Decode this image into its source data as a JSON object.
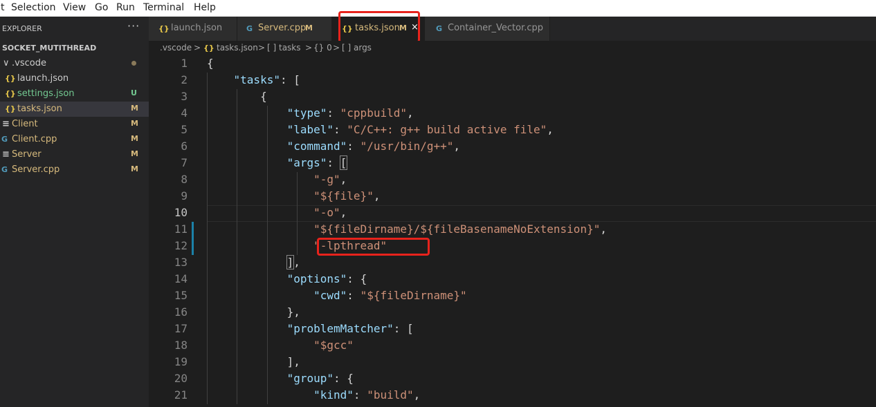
{
  "menu": [
    "t",
    "Selection",
    "View",
    "Go",
    "Run",
    "Terminal",
    "Help"
  ],
  "explorer": {
    "title": "EXPLORER",
    "more": "···",
    "project": "SOCKET_MUTITHREAD",
    "items": [
      {
        "label": ".vscode",
        "badge": "",
        "icon": "",
        "kind": "folder"
      },
      {
        "label": "launch.json",
        "badge": "",
        "icon": "{}",
        "kind": "json"
      },
      {
        "label": "settings.json",
        "badge": "U",
        "icon": "{}",
        "kind": "json"
      },
      {
        "label": "tasks.json",
        "badge": "M",
        "icon": "{}",
        "kind": "json"
      },
      {
        "label": "Client",
        "badge": "M",
        "icon": "≡",
        "kind": "binary"
      },
      {
        "label": "Client.cpp",
        "badge": "M",
        "icon": "G",
        "kind": "cpp"
      },
      {
        "label": "Server",
        "badge": "M",
        "icon": "≡",
        "kind": "binary"
      },
      {
        "label": "Server.cpp",
        "badge": "M",
        "icon": "G",
        "kind": "cpp"
      }
    ]
  },
  "tabs": [
    {
      "label": "launch.json",
      "badge": "",
      "icon": "{}"
    },
    {
      "label": "Server.cpp",
      "badge": "M",
      "icon": "G"
    },
    {
      "label": "tasks.json",
      "badge": "M",
      "icon": "{}",
      "close": "×"
    },
    {
      "label": "Container_Vector.cpp",
      "badge": "",
      "icon": "G"
    }
  ],
  "breadcrumb": [
    ".vscode",
    ">",
    "{}",
    "tasks.json",
    ">",
    "[ ] tasks",
    ">",
    "{} 0",
    ">",
    "[ ] args"
  ],
  "editor": {
    "line_numbers": [
      "1",
      "2",
      "3",
      "4",
      "5",
      "6",
      "7",
      "8",
      "9",
      "10",
      "11",
      "12",
      "13",
      "14",
      "15",
      "16",
      "17",
      "18",
      "19",
      "20",
      "21"
    ],
    "current_line": "10",
    "lines": [
      [
        [
          "p",
          "{"
        ]
      ],
      [
        [
          "p",
          "    "
        ],
        [
          "k",
          "\"tasks\""
        ],
        [
          "p",
          ": ["
        ]
      ],
      [
        [
          "p",
          "        {"
        ]
      ],
      [
        [
          "p",
          "            "
        ],
        [
          "k",
          "\"type\""
        ],
        [
          "p",
          ": "
        ],
        [
          "s",
          "\"cppbuild\""
        ],
        [
          "p",
          ","
        ]
      ],
      [
        [
          "p",
          "            "
        ],
        [
          "k",
          "\"label\""
        ],
        [
          "p",
          ": "
        ],
        [
          "s",
          "\"C/C++: g++ build active file\""
        ],
        [
          "p",
          ","
        ]
      ],
      [
        [
          "p",
          "            "
        ],
        [
          "k",
          "\"command\""
        ],
        [
          "p",
          ": "
        ],
        [
          "s",
          "\"/usr/bin/g++\""
        ],
        [
          "p",
          ","
        ]
      ],
      [
        [
          "p",
          "            "
        ],
        [
          "k",
          "\"args\""
        ],
        [
          "p",
          ": "
        ],
        [
          "m",
          "["
        ]
      ],
      [
        [
          "p",
          "                "
        ],
        [
          "s",
          "\"-g\""
        ],
        [
          "p",
          ","
        ]
      ],
      [
        [
          "p",
          "                "
        ],
        [
          "s",
          "\"${file}\""
        ],
        [
          "p",
          ","
        ]
      ],
      [
        [
          "p",
          "                "
        ],
        [
          "s",
          "\"-o\""
        ],
        [
          "p",
          ","
        ]
      ],
      [
        [
          "p",
          "                "
        ],
        [
          "s",
          "\"${fileDirname}/${fileBasenameNoExtension}\""
        ],
        [
          "p",
          ","
        ]
      ],
      [
        [
          "p",
          "                "
        ],
        [
          "s",
          "\"-lpthread\""
        ]
      ],
      [
        [
          "p",
          "            "
        ],
        [
          "m",
          "]"
        ],
        [
          "p",
          ","
        ]
      ],
      [
        [
          "p",
          "            "
        ],
        [
          "k",
          "\"options\""
        ],
        [
          "p",
          ": {"
        ]
      ],
      [
        [
          "p",
          "                "
        ],
        [
          "k",
          "\"cwd\""
        ],
        [
          "p",
          ": "
        ],
        [
          "s",
          "\"${fileDirname}\""
        ]
      ],
      [
        [
          "p",
          "            },"
        ]
      ],
      [
        [
          "p",
          "            "
        ],
        [
          "k",
          "\"problemMatcher\""
        ],
        [
          "p",
          ": ["
        ]
      ],
      [
        [
          "p",
          "                "
        ],
        [
          "s",
          "\"$gcc\""
        ]
      ],
      [
        [
          "p",
          "            ],"
        ]
      ],
      [
        [
          "p",
          "            "
        ],
        [
          "k",
          "\"group\""
        ],
        [
          "p",
          ": {"
        ]
      ],
      [
        [
          "p",
          "                "
        ],
        [
          "k",
          "\"kind\""
        ],
        [
          "p",
          ": "
        ],
        [
          "s",
          "\"build\""
        ],
        [
          "p",
          ","
        ]
      ]
    ]
  },
  "colors": {
    "key": "#9cdcfe",
    "string": "#ce9178",
    "json_icon": "#e8c84a",
    "cpp_icon": "#519aba",
    "modified": "#d7ba7d",
    "untracked": "#73c991",
    "highlight": "#e8231c"
  }
}
